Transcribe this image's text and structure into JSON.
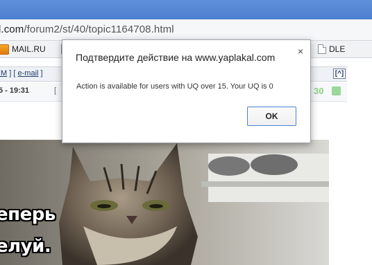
{
  "browser": {
    "url_host_fragment": "l.com",
    "url_path": "/forum2/st/40/topic1164708.html",
    "bookmarks": [
      {
        "label": "MAIL.RU",
        "icon": "mailru-icon"
      },
      {
        "label": "DLE",
        "icon": "page-icon"
      }
    ]
  },
  "forum": {
    "pm_fragment": "IM",
    "pm_separator": " ] [ ",
    "email_label": "e-mail",
    "pm_close": " ]",
    "scroll_up_label": "[^]",
    "post_time": "5 - 19:31",
    "post_bracket": "[",
    "rating": "30"
  },
  "image": {
    "caption_line1": "еперь",
    "caption_line2": "елуй."
  },
  "dialog": {
    "title": "Подтвердите действие на www.yaplakal.com",
    "message": "Action is available for users with UQ over 15. Your UQ is 0",
    "ok_label": "OK",
    "close_label": "×"
  }
}
